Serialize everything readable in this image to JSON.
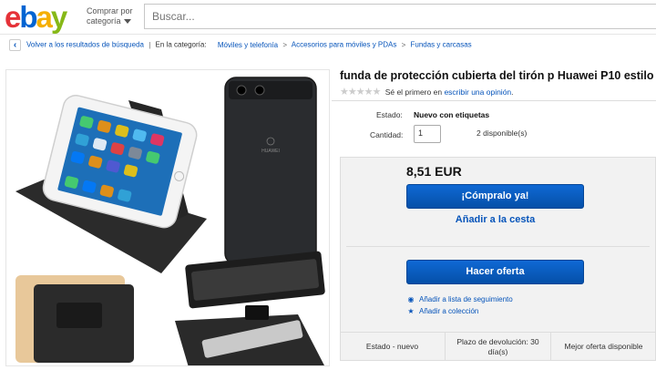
{
  "header": {
    "logo_letters": [
      "e",
      "b",
      "a",
      "y"
    ],
    "category_label_line1": "Comprar por",
    "category_label_line2": "categoría",
    "search_placeholder": "Buscar..."
  },
  "breadcrumb": {
    "back_label": "Volver a los resultados de búsqueda",
    "category_prefix": "En la categoría:",
    "items": [
      "Móviles y telefonía",
      "Accesorios para móviles y PDAs",
      "Fundas y carcasas"
    ]
  },
  "product": {
    "title": "funda de protección cubierta del tirón p Huawei P10 estilo",
    "rating_text": "Sé el primero en",
    "rating_link": "escribir una opinión",
    "rating_suffix": ".",
    "condition_label": "Estado:",
    "condition_value": "Nuevo con etiquetas",
    "quantity_label": "Cantidad:",
    "quantity_value": "1",
    "available": "2 disponible(s)",
    "phone_brand": "HUAWEI"
  },
  "purchase": {
    "price": "8,51 EUR",
    "buy_now": "¡Cómpralo ya!",
    "add_to_cart": "Añadir a la cesta",
    "make_offer": "Hacer oferta",
    "watchlist": "Añadir a lista de seguimiento",
    "collection": "Añadir a colección"
  },
  "features": [
    "Estado - nuevo",
    "Plazo de devolución: 30 día(s)",
    "Mejor oferta disponible"
  ],
  "colors": {
    "ebay_red": "#e53238",
    "ebay_blue": "#0064d2",
    "ebay_yellow": "#f5af02",
    "ebay_green": "#86b817",
    "button_blue": "#0654ba",
    "link_blue": "#0654ba"
  }
}
